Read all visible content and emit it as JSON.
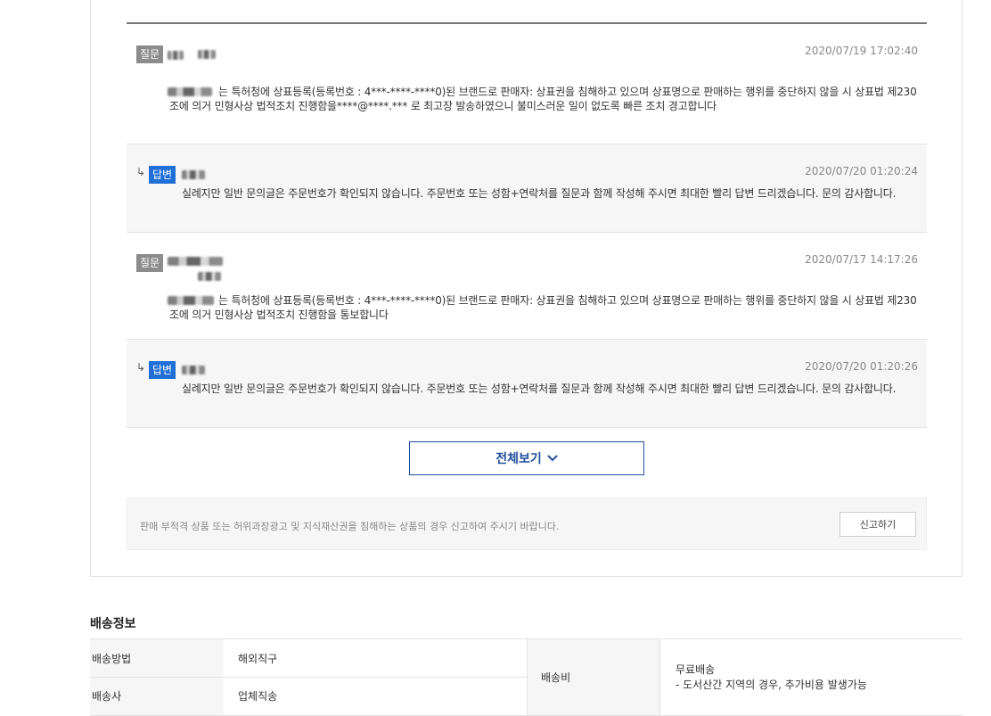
{
  "qa": {
    "items": [
      {
        "type": "question",
        "badge": "질문",
        "date": "2020/07/19 17:02:40",
        "text": "는 특허청에 상표등록(등록번호 : 4***-****-****0)된 브랜드로 판매자: 상표권을 침해하고 있으며 상표명으로 판매하는 행위를 중단하지 않을 시 상표법 제230조에 의거 민형사상 법적조치 진행함을****@****.*** 로 최고장 발송하였으니 불미스러운 일이 없도록 빠른 조치 경고합니다"
      },
      {
        "type": "answer",
        "badge": "답변",
        "date": "2020/07/20 01:20:24",
        "text": "실례지만 일반 문의글은 주문번호가 확인되지 않습니다. 주문번호 또는 성함+연락처를 질문과 함께 작성해 주시면 최대한 빨리 답변 드리겠습니다. 문의 감사합니다."
      },
      {
        "type": "question",
        "badge": "질문",
        "date": "2020/07/17 14:17:26",
        "text": "는 특허청에 상표등록(등록번호 : 4***-****-****0)된 브랜드로 판매자: 상표권을 침해하고 있으며 상표명으로 판매하는 행위를 중단하지 않을 시 상표법 제230조에 의거 민형사상 법적조치 진행함을 통보합니다"
      },
      {
        "type": "answer",
        "badge": "답변",
        "date": "2020/07/20 01:20:26",
        "text": "실례지만 일반 문의글은 주문번호가 확인되지 않습니다. 주문번호 또는 성함+연락처를 질문과 함께 작성해 주시면 최대한 빨리 답변 드리겠습니다. 문의 감사합니다."
      }
    ],
    "arrow_glyph": "↳",
    "more_button": "전체보기",
    "report": {
      "text": "판매 부적격 상품 또는 허위과장광고 및 지식재산권을 침해하는 상품의 경우 신고하여 주시기 바랍니다.",
      "button": "신고하기"
    }
  },
  "shipping": {
    "title": "배송정보",
    "method_label": "배송방법",
    "method_value": "해외직구",
    "carrier_label": "배송사",
    "carrier_value": "업체직송",
    "fee_label": "배송비",
    "fee_value": "무료배송",
    "fee_note": "- 도서산간 지역의 경우, 추가비용 발생가능"
  },
  "colors": {
    "accent": "#1f6fd6",
    "question_badge": "#8c8c8c",
    "more_border": "#1f4e9c"
  }
}
